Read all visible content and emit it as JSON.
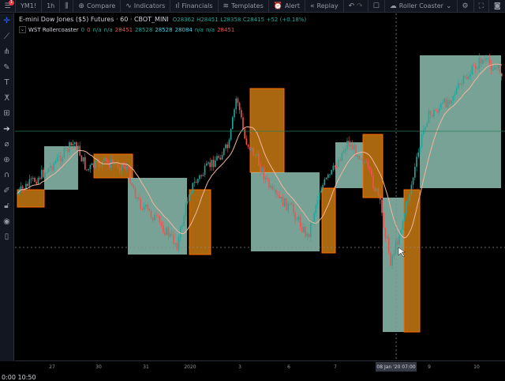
{
  "toolbar": {
    "notifications": "1",
    "symbol": "YM1!",
    "interval": "1h",
    "compare": "Compare",
    "indicators": "Indicators",
    "financials": "Financials",
    "templates": "Templates",
    "alert": "Alert",
    "replay": "Replay",
    "layout_name": "Roller Coaster"
  },
  "legend": {
    "title": "E-mini Dow Jones ($5) Futures · 60 · CBOT_MINI",
    "open": "O28362",
    "high": "H28451",
    "low": "L28358",
    "close": "C28415",
    "change": "+52 (+0.18%)",
    "indicator": {
      "name": "WST Rollercoaster",
      "values": [
        {
          "v": "0",
          "c": "g"
        },
        {
          "v": "0",
          "c": "r"
        },
        {
          "v": "n/a",
          "c": "g"
        },
        {
          "v": "n/a",
          "c": "g"
        },
        {
          "v": "28451",
          "c": "r"
        },
        {
          "v": "28528",
          "c": "g"
        },
        {
          "v": "28528",
          "c": "c"
        },
        {
          "v": "28084",
          "c": "c"
        },
        {
          "v": "n/a",
          "c": "g"
        },
        {
          "v": "n/a",
          "c": "g"
        },
        {
          "v": "28451",
          "c": "r"
        }
      ]
    }
  },
  "time_axis": {
    "labels": [
      "27",
      "30",
      "31",
      "2020",
      "3",
      "6",
      "7",
      "9",
      "10"
    ],
    "crosshair_label": "08 Jan '20  07:00"
  },
  "clock": "0:00 10:50",
  "colors": {
    "up": "#26a69a",
    "down": "#ef5350",
    "orange_box": "#c77a12",
    "teal_box": "#9fd8c7",
    "background": "#000000"
  }
}
